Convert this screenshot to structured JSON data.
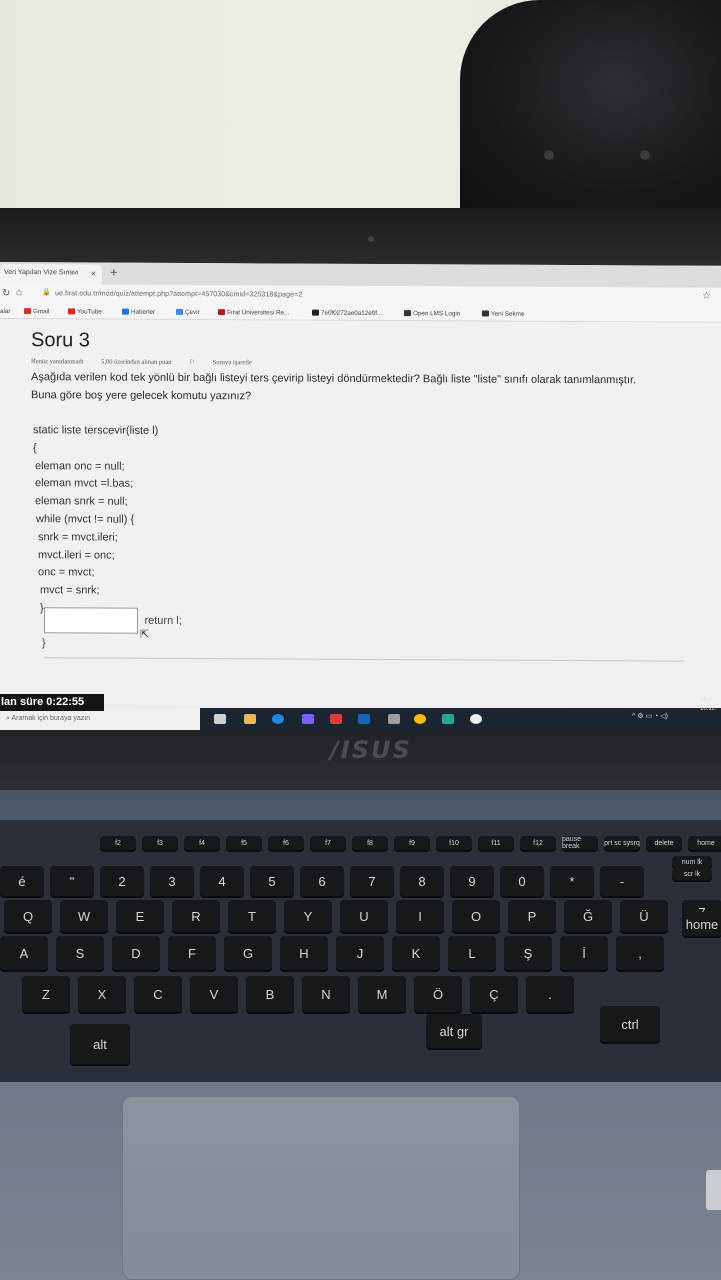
{
  "browser": {
    "tab_title": "Veri Yapıları Vize Sınavı",
    "tab_close": "×",
    "new_tab": "+",
    "url": "ue.firat.edu.tr/mod/quiz/attempt.php?attempt=457030&cmid=325318&page=2",
    "bookmarks": [
      {
        "label": "alar",
        "color": "#888888"
      },
      {
        "label": "Gmail",
        "color": "#d93025"
      },
      {
        "label": "YouTube",
        "color": "#e62117"
      },
      {
        "label": "Haberler",
        "color": "#1a73e8"
      },
      {
        "label": "Çevir",
        "color": "#4285f4"
      },
      {
        "label": "Fırat Üniversitesi Re...",
        "color": "#b71c1c"
      },
      {
        "label": "7e0f0272ae0a12e0f...",
        "color": "#222222"
      },
      {
        "label": "Open LMS Login",
        "color": "#333333"
      },
      {
        "label": "Yeni Sekme",
        "color": "#333333"
      }
    ]
  },
  "quiz": {
    "title": "Soru 3",
    "status": "Henüz yanıtlanmadı",
    "points": "5,00 üzerinden alınan puan",
    "flag": "Soruyu işaretle",
    "question_line1": "Aşağıda verilen kod tek yönlü bir bağlı listeyi ters çevirip listeyi döndürmektedir? Bağlı liste \"liste\" sınıfı olarak tanımlanmıştır.",
    "question_line2": "Buna göre boş yere gelecek komutu yazınız?",
    "code": [
      "static liste terscevir(liste l)",
      "{",
      "eleman onc = null;",
      "eleman mvct =l.bas;",
      "eleman snrk = null;",
      "while (mvct != null) {",
      "snrk = mvct.ileri;",
      "mvct.ileri = onc;",
      "onc = mvct;",
      "mvct = snrk;",
      "}"
    ],
    "answer_value": "",
    "after_input": "return l;",
    "closing_brace": "}"
  },
  "timer": {
    "label": "lan süre",
    "value": "0:22:55"
  },
  "taskbar": {
    "search_placeholder": "Aramak için buraya yazın",
    "clock_time": "16:0",
    "clock_date": "10.12."
  },
  "laptop": {
    "brand": "/ISUS"
  },
  "keyboard": {
    "fn_row": [
      "f2",
      "f3",
      "f4",
      "f5",
      "f6",
      "f7",
      "f8",
      "f9",
      "f10",
      "f11",
      "f12",
      "pause break",
      "prt sc sysrq",
      "delete",
      "home"
    ],
    "number_row": [
      "é",
      "\"",
      "2",
      "3",
      "4",
      "5",
      "6",
      "7",
      "8",
      "9",
      "0",
      "*",
      "-"
    ],
    "q_row": [
      "Q",
      "W",
      "E",
      "R",
      "T",
      "Y",
      "U",
      "I",
      "O",
      "P",
      "Ğ",
      "Ü"
    ],
    "a_row": [
      "A",
      "S",
      "D",
      "F",
      "G",
      "H",
      "J",
      "K",
      "L",
      "Ş",
      "İ",
      ","
    ],
    "z_row": [
      "Z",
      "X",
      "C",
      "V",
      "B",
      "N",
      "M",
      "Ö",
      "Ç",
      "."
    ],
    "bottom_row": [
      "alt",
      "alt gr",
      "ctrl"
    ],
    "numpad": [
      "num lk",
      "scr lk",
      "7",
      "home"
    ]
  }
}
